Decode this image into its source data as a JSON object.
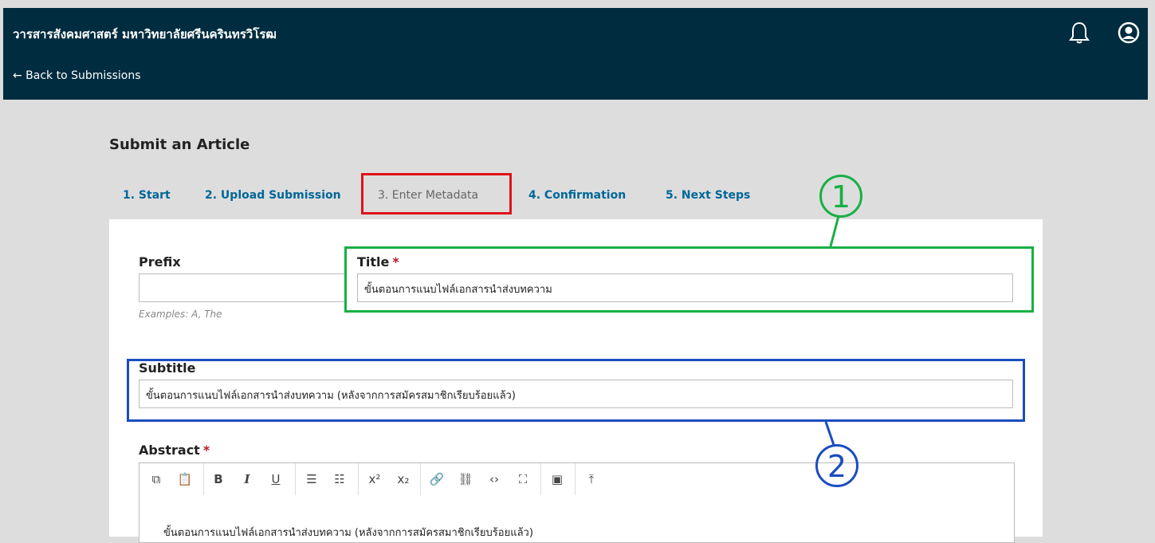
{
  "header": {
    "site_title": "วารสารสังคมศาสตร์ มหาวิทยาลัยศรีนครินทรวิโรฒ",
    "back_link": "← Back to Submissions"
  },
  "page_title": "Submit an Article",
  "tabs": [
    {
      "label": "1. Start"
    },
    {
      "label": "2. Upload Submission"
    },
    {
      "label": "3. Enter Metadata"
    },
    {
      "label": "4. Confirmation"
    },
    {
      "label": "5. Next Steps"
    }
  ],
  "form": {
    "prefix_label": "Prefix",
    "prefix_value": "",
    "prefix_help": "Examples: A, The",
    "title_label": "Title",
    "title_value": "ขั้นตอนการแนบไฟล์เอกสารนำส่งบทความ",
    "subtitle_label": "Subtitle",
    "subtitle_value": "ขั้นตอนการแนบไฟล์เอกสารนำส่งบทความ (หลังจากการสมัครสมาชิกเรียบร้อยแล้ว)",
    "abstract_label": "Abstract",
    "abstract_value": "ขั้นตอนการแนบไฟล์เอกสารนำส่งบทความ (หลังจากการสมัครสมาชิกเรียบร้อยแล้ว)",
    "required_mark": "*"
  },
  "annotations": {
    "callout_1": "1",
    "callout_2": "2"
  },
  "colors": {
    "header_bg": "#002c3f",
    "tab_link": "#006798",
    "highlight_red": "#e0121a",
    "highlight_green": "#17b043",
    "highlight_blue": "#1a4dbf"
  }
}
